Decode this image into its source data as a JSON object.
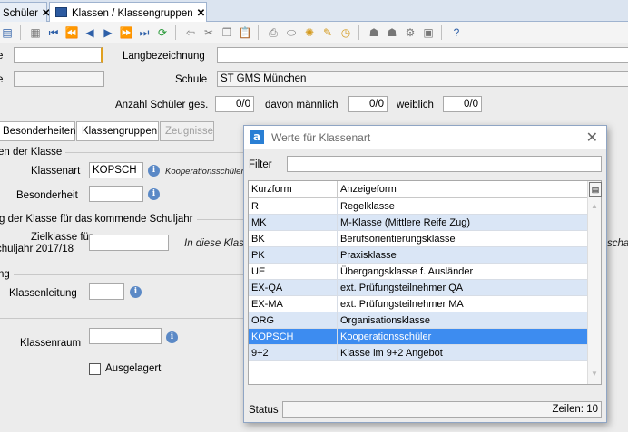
{
  "tabs": [
    {
      "label": "Schüler"
    },
    {
      "label": "Klassen / Klassengruppen"
    }
  ],
  "form": {
    "langbezeichnung_label": "Langbezeichnung",
    "schule_label": "Schule",
    "schule_value": "ST GMS München",
    "anzahl_label": "Anzahl Schüler ges.",
    "anzahl_value": "0/0",
    "maennlich_label": "davon männlich",
    "maennlich_value": "0/0",
    "weiblich_label": "weiblich",
    "weiblich_value": "0/0"
  },
  "subtabs": [
    "Besonderheiten",
    "Klassengruppen",
    "Zeugnisse"
  ],
  "section1": {
    "title": "en der Klasse",
    "klassenart_label": "Klassenart",
    "klassenart_value": "KOPSCH",
    "klassenart_hint": "Kooperationsschüler",
    "besonderheit_label": "Besonderheit"
  },
  "section2": {
    "title": "g der Klasse für das kommende Schuljahr",
    "zielklasse_label1": "Zielklasse für",
    "zielklasse_label2": "chuljahr 2017/18",
    "hint": "In diese Klass",
    "hint_right": "schal"
  },
  "section3": {
    "title": "ng",
    "klassenleitung_label": "Klassenleitung"
  },
  "section4": {
    "klassenraum_label": "Klassenraum",
    "ausgelagert_label": "Ausgelagert"
  },
  "dialog": {
    "title": "Werte für Klassenart",
    "logo": "a",
    "filter_label": "Filter",
    "columns": [
      "Kurzform",
      "Anzeigeform"
    ],
    "rows": [
      {
        "k": "R",
        "a": "Regelklasse"
      },
      {
        "k": "MK",
        "a": "M-Klasse (Mittlere Reife Zug)"
      },
      {
        "k": "BK",
        "a": "Berufsorientierungsklasse"
      },
      {
        "k": "PK",
        "a": "Praxisklasse"
      },
      {
        "k": "UE",
        "a": "Übergangsklasse f. Ausländer"
      },
      {
        "k": "EX-QA",
        "a": "ext. Prüfungsteilnehmer QA"
      },
      {
        "k": "EX-MA",
        "a": "ext. Prüfungsteilnehmer MA"
      },
      {
        "k": "ORG",
        "a": "Organisationsklasse"
      },
      {
        "k": "KOPSCH",
        "a": "Kooperationsschüler"
      },
      {
        "k": "9+2",
        "a": "Klasse im 9+2 Angebot"
      }
    ],
    "selected_index": 8,
    "status_label": "Status",
    "rows_count_text": "Zeilen: 10"
  },
  "colors": {
    "selected_row": "#3d8cf0",
    "alt_row": "#dae6f6",
    "accent": "#2d5fa8"
  }
}
